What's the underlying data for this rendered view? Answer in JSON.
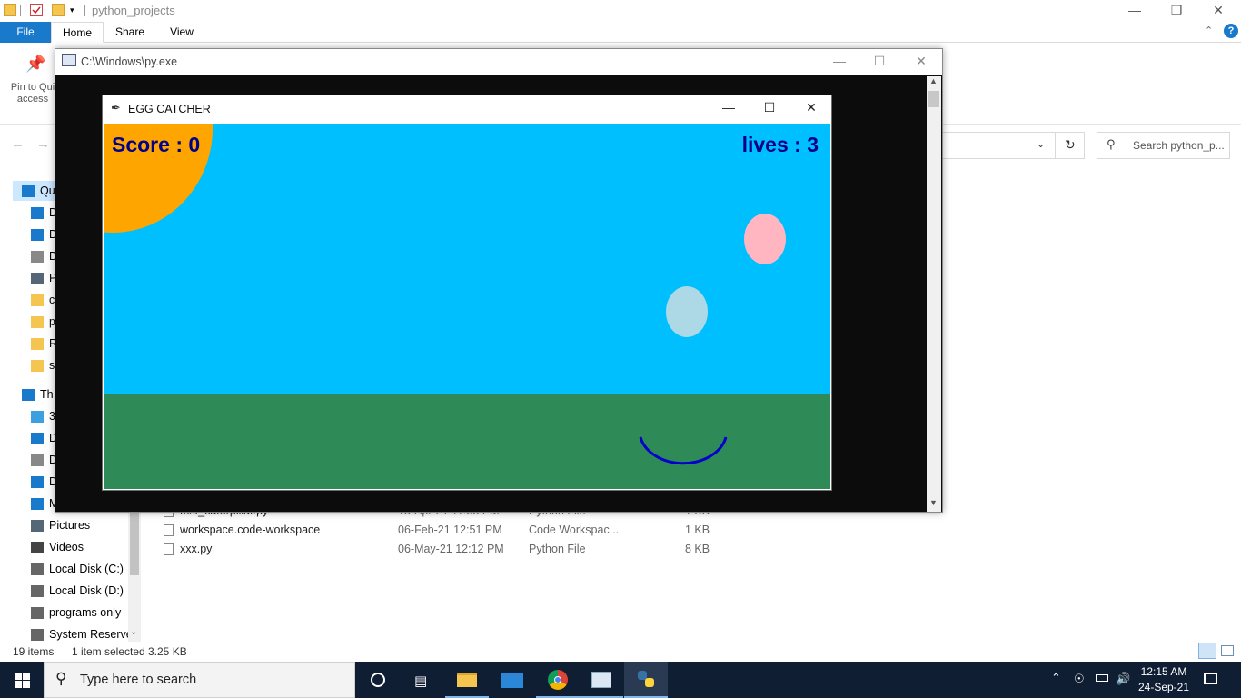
{
  "explorer": {
    "title": "python_projects",
    "ribbon_tabs": [
      "File",
      "Home",
      "Share",
      "View"
    ],
    "pin_label": "Pin to Quick access",
    "pin_label_visible": "Pin to Qui access",
    "search_placeholder": "Search python_p...",
    "nav_items": [
      {
        "label": "Qu",
        "icon": "star-icon"
      },
      {
        "label": "D",
        "icon": "desktop-icon"
      },
      {
        "label": "D",
        "icon": "download-icon"
      },
      {
        "label": "D",
        "icon": "document-icon"
      },
      {
        "label": "P",
        "icon": "pictures-icon"
      },
      {
        "label": "c",
        "icon": "folder-icon"
      },
      {
        "label": "p",
        "icon": "folder-icon"
      },
      {
        "label": "R",
        "icon": "folder-icon"
      },
      {
        "label": "s",
        "icon": "folder-icon"
      },
      {
        "label": "Th",
        "icon": "computer-icon"
      },
      {
        "label": "3",
        "icon": "3d-objects-icon"
      },
      {
        "label": "D",
        "icon": "desktop-icon"
      },
      {
        "label": "D",
        "icon": "document-icon"
      },
      {
        "label": "D",
        "icon": "download-icon"
      },
      {
        "label": "M",
        "icon": "music-icon"
      },
      {
        "label": "Pictures",
        "icon": "pictures-icon"
      },
      {
        "label": "Videos",
        "icon": "videos-icon"
      },
      {
        "label": "Local Disk (C:)",
        "icon": "drive-icon"
      },
      {
        "label": "Local Disk (D:)",
        "icon": "drive-icon"
      },
      {
        "label": "programs only",
        "icon": "drive-icon"
      },
      {
        "label": "System Reserve",
        "icon": "drive-icon"
      }
    ],
    "files": [
      {
        "name": "test_caterpillar.py",
        "date": "15-Apr-21 11:35 PM",
        "type": "Python File",
        "size": "1 KB"
      },
      {
        "name": "workspace.code-workspace",
        "date": "06-Feb-21 12:51 PM",
        "type": "Code Workspac...",
        "size": "1 KB"
      },
      {
        "name": "xxx.py",
        "date": "06-May-21 12:12 PM",
        "type": "Python File",
        "size": "8 KB"
      }
    ],
    "status": {
      "items": "19 items",
      "selected": "1 item selected",
      "size": "3.25 KB"
    }
  },
  "console": {
    "title": "C:\\Windows\\py.exe"
  },
  "game": {
    "title": "EGG CATCHER",
    "score_text": "Score : 0",
    "lives_text": "lives : 3",
    "colors": {
      "sky": "#00bfff",
      "grass": "#2e8b57",
      "sun": "#ffa500",
      "text": "#00008b",
      "catcher": "#0000cd",
      "egg_pink": "#ffb6c1",
      "egg_blue": "#add8e6"
    }
  },
  "taskbar": {
    "search_placeholder": "Type here to search",
    "time": "12:15 AM",
    "date": "24-Sep-21"
  }
}
